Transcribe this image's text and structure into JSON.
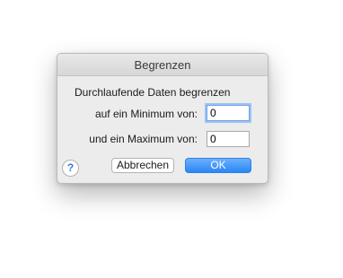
{
  "dialog": {
    "title": "Begrenzen",
    "heading": "Durchlaufende Daten begrenzen",
    "min_label": "auf ein Minimum von:",
    "min_value": "0",
    "max_label": "und ein Maximum von:",
    "max_value": "0",
    "help_glyph": "?",
    "cancel_label": "Abbrechen",
    "ok_label": "OK"
  },
  "colors": {
    "accent": "#2a86f7",
    "focus_ring": "#9cc3f3",
    "dialog_bg": "#ececec"
  }
}
